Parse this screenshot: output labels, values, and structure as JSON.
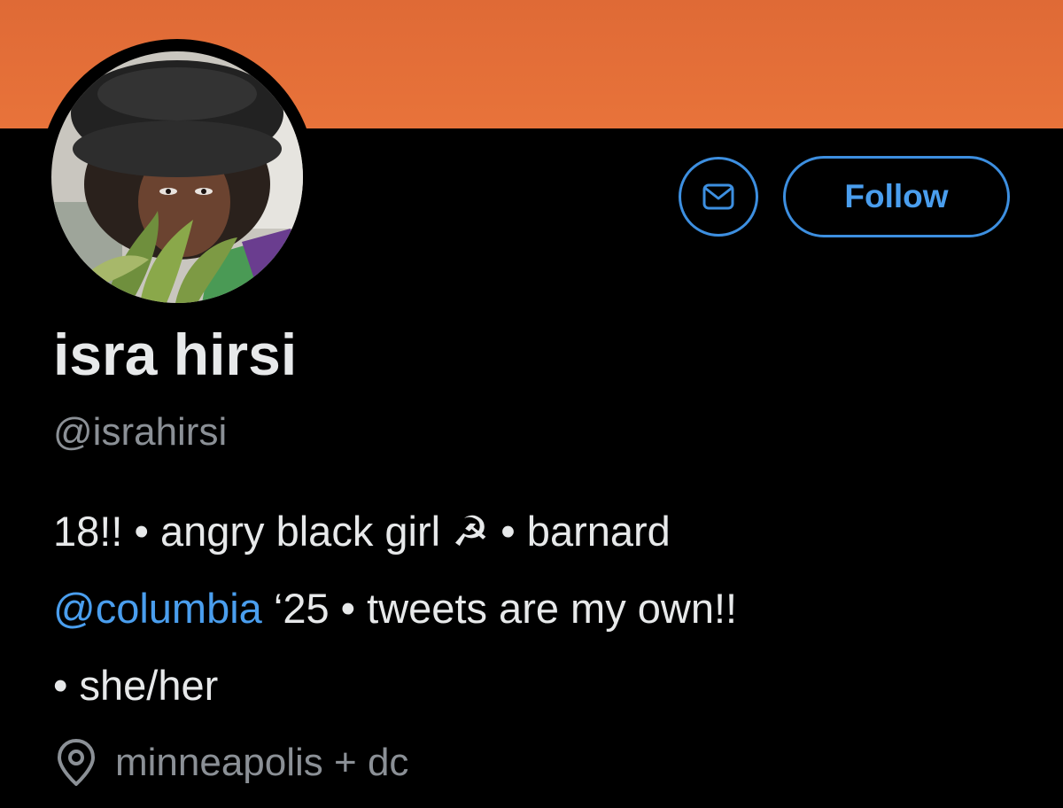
{
  "banner": {
    "color": "#e8733a"
  },
  "avatar": {
    "alt": "profile photo"
  },
  "actions": {
    "message_icon": "envelope-icon",
    "follow_label": "Follow"
  },
  "profile": {
    "display_name": "isra hirsi",
    "handle": "@israhirsi"
  },
  "bio": {
    "line1": "18!! • angry black girl ☭ • barnard",
    "mention": "@columbia",
    "line2_rest": " ‘25 • tweets are my own!!",
    "line3": "• she/her"
  },
  "location": {
    "icon": "location-pin-icon",
    "text": "minneapolis + dc"
  },
  "colors": {
    "accent": "#4a9eee",
    "background": "#000000",
    "muted": "#8b9096"
  }
}
